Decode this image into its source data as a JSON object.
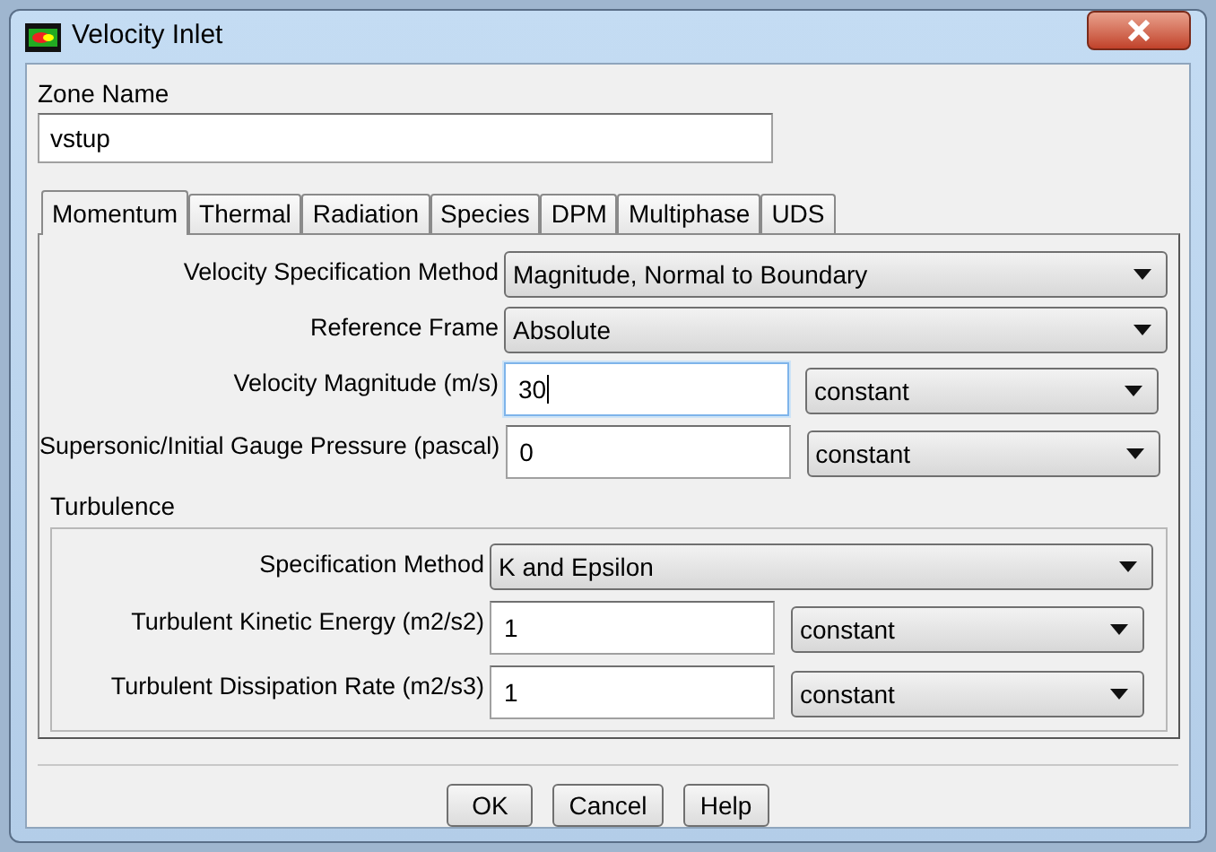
{
  "window": {
    "title": "Velocity Inlet"
  },
  "zone_name": {
    "label": "Zone Name",
    "value": "vstup"
  },
  "tabs": [
    {
      "label": "Momentum",
      "selected": true
    },
    {
      "label": "Thermal",
      "selected": false
    },
    {
      "label": "Radiation",
      "selected": false
    },
    {
      "label": "Species",
      "selected": false
    },
    {
      "label": "DPM",
      "selected": false
    },
    {
      "label": "Multiphase",
      "selected": false
    },
    {
      "label": "UDS",
      "selected": false
    }
  ],
  "momentum_rows": [
    {
      "kind": "select",
      "label": "Velocity Specification Method",
      "value": "Magnitude, Normal to Boundary"
    },
    {
      "kind": "select",
      "label": "Reference Frame",
      "value": "Absolute"
    },
    {
      "kind": "input",
      "label": "Velocity Magnitude (m/s)",
      "value": "30",
      "focused": true,
      "profile": "constant"
    },
    {
      "kind": "input",
      "label": "Supersonic/Initial Gauge Pressure (pascal)",
      "value": "0",
      "focused": false,
      "profile": "constant"
    }
  ],
  "turbulence": {
    "title": "Turbulence",
    "rows": [
      {
        "kind": "select",
        "label": "Specification Method",
        "value": "K and Epsilon"
      },
      {
        "kind": "input",
        "label": "Turbulent Kinetic Energy (m2/s2)",
        "value": "1",
        "focused": false,
        "profile": "constant"
      },
      {
        "kind": "input",
        "label": "Turbulent Dissipation Rate (m2/s3)",
        "value": "1",
        "focused": false,
        "profile": "constant"
      }
    ]
  },
  "buttons": [
    "OK",
    "Cancel",
    "Help"
  ]
}
